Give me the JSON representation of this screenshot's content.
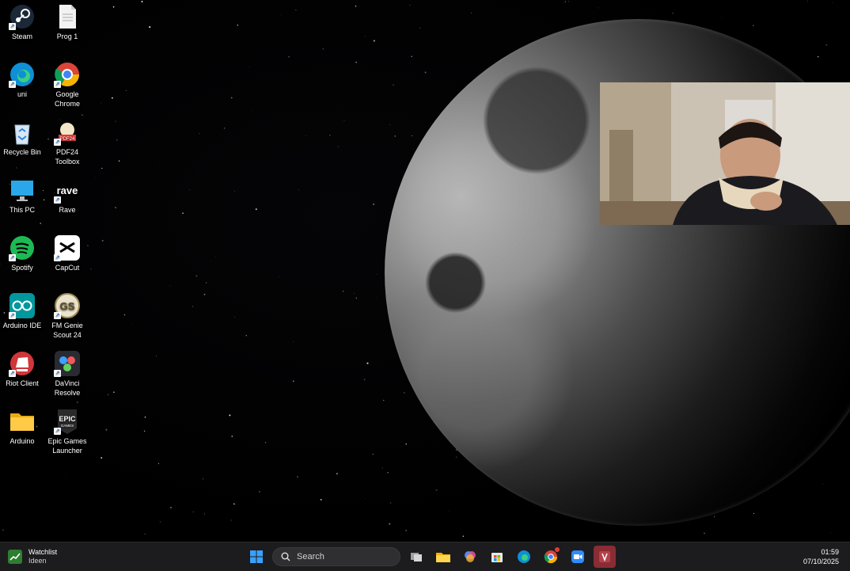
{
  "desktop": {
    "icons": [
      {
        "label": "Steam",
        "icon": "steam-icon"
      },
      {
        "label": "Prog 1",
        "icon": "text-file-icon"
      },
      {
        "label": "uni",
        "icon": "edge-icon"
      },
      {
        "label": "Google Chrome",
        "icon": "chrome-icon"
      },
      {
        "label": "Recycle Bin",
        "icon": "recycle-bin-icon"
      },
      {
        "label": "PDF24 Toolbox",
        "icon": "pdf24-icon"
      },
      {
        "label": "This PC",
        "icon": "monitor-icon"
      },
      {
        "label": "Rave",
        "icon": "rave-icon"
      },
      {
        "label": "Spotify",
        "icon": "spotify-icon"
      },
      {
        "label": "CapCut",
        "icon": "capcut-icon"
      },
      {
        "label": "Arduino IDE",
        "icon": "arduino-icon"
      },
      {
        "label": "FM Genie Scout 24",
        "icon": "fm-genie-scout-icon"
      },
      {
        "label": "Riot Client",
        "icon": "riot-client-icon"
      },
      {
        "label": "DaVinci Resolve",
        "icon": "davinci-resolve-icon"
      },
      {
        "label": "Arduino",
        "icon": "folder-icon"
      },
      {
        "label": "Epic Games Launcher",
        "icon": "epic-games-icon"
      }
    ]
  },
  "taskbar": {
    "widget": {
      "title": "Watchlist",
      "subtitle": "Ideen",
      "icon": "stock-chart-icon"
    },
    "search": {
      "placeholder": "Search",
      "icon": "search-icon"
    },
    "apps": [
      "windows-start-icon",
      "task-view-icon",
      "file-explorer-icon",
      "copilot-icon",
      "store-icon",
      "edge-icon",
      "chrome-icon",
      "zoom-icon",
      "video-editor-icon"
    ],
    "clock": {
      "time": "01:59",
      "date": "07/10/2025"
    }
  },
  "colors": {
    "taskbar_bg": "#1c1c1e",
    "accent_blue": "#0078d4"
  }
}
